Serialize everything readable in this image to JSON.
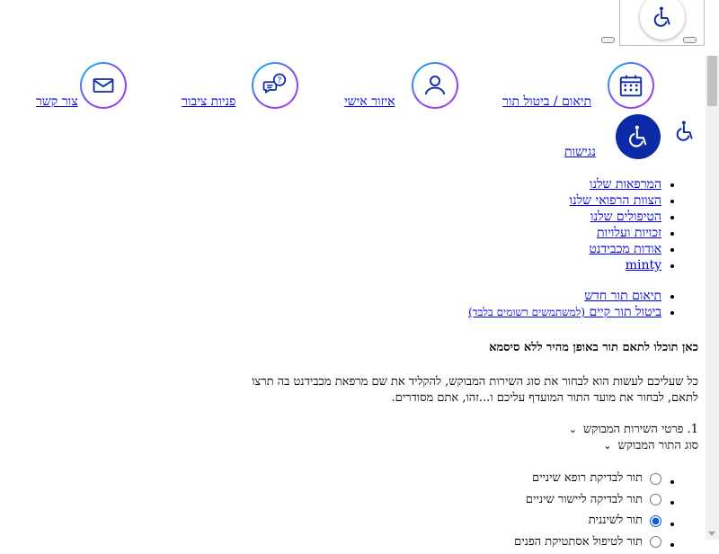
{
  "nav": {
    "items": [
      {
        "label": "צור קשר",
        "icon": "mail-icon"
      },
      {
        "label": "פניות ציבור",
        "icon": "chat-question-icon"
      },
      {
        "label": "איזור אישי",
        "icon": "user-icon"
      },
      {
        "label": "תיאום / ביטול תור",
        "icon": "calendar-icon"
      }
    ],
    "accessibility_label": "נגישות"
  },
  "menu": [
    "המרפאות שלנו",
    "הצוות הרפואי שלנו",
    "הטיפולים שלנו",
    "זכויות ועלויות",
    "אודות מכבידנט",
    "minty"
  ],
  "appointments": {
    "new": "תיאום תור חדש",
    "cancel": "ביטול תור קיים",
    "cancel_note": "(למשתמשים רשומים בלבד)"
  },
  "headline": "כאן תוכלו לתאם תור באופן מהיר ללא סיסמא",
  "paragraph": "כל שעליכם לעשות הוא לבחור את סוג השירות המבוקש, להקליד את שם מרפאת מכבידנט בה תרצו לתאם, לבחור את מועד התור המועדף עליכם ו...זהו, אתם מסודרים.",
  "step": {
    "number": "1.",
    "title": "פרטי השירות המבוקש",
    "subtitle": "סוג התור המבוקש"
  },
  "appointment_types": [
    {
      "label": "תור לבדיקת רופא שיניים",
      "selected": false
    },
    {
      "label": "תור לבדיקה ליישור שיניים",
      "selected": false
    },
    {
      "label": "תור לשיננית",
      "selected": true
    },
    {
      "label": "תור לטיפול אסתטיקת הפנים",
      "selected": false
    }
  ],
  "colors": {
    "accent": "#0d2aa6",
    "link": "#0000ee"
  }
}
